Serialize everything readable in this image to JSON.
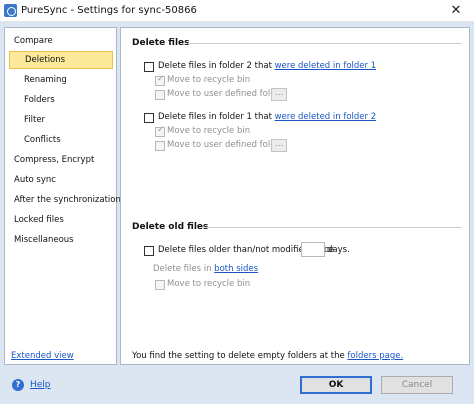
{
  "window": {
    "title": "PureSync - Settings for sync-50866",
    "close_glyph": "✕"
  },
  "sidebar": {
    "items": [
      {
        "label": "Compare"
      },
      {
        "label": "Deletions"
      },
      {
        "label": "Renaming"
      },
      {
        "label": "Folders"
      },
      {
        "label": "Filter"
      },
      {
        "label": "Conflicts"
      },
      {
        "label": "Compress, Encrypt"
      },
      {
        "label": "Auto sync"
      },
      {
        "label": "After the synchronization"
      },
      {
        "label": "Locked files"
      },
      {
        "label": "Miscellaneous"
      }
    ],
    "selected": "Deletions",
    "extended_view_link": "Extended view"
  },
  "delete_files": {
    "title": "Delete files",
    "folder2": {
      "label": "Delete files in folder 2 that",
      "link": "were deleted in folder 1",
      "checked": false,
      "recycle_label": "Move to recycle bin",
      "recycle_checked": true,
      "user_folder_label": "Move to user defined foler",
      "user_folder_checked": false,
      "browse_label": "..."
    },
    "folder1": {
      "label": "Delete files in folder 1 that",
      "link": "were deleted in folder 2",
      "checked": false,
      "recycle_label": "Move to recycle bin",
      "recycle_checked": true,
      "user_folder_label": "Move to user defined foler",
      "user_folder_checked": false,
      "browse_label": "..."
    }
  },
  "delete_old_files": {
    "title": "Delete old files",
    "older_than_label": "Delete files older than/not modified since",
    "older_than_checked": false,
    "days_value": "",
    "days_suffix": "days.",
    "delete_in_label": "Delete files in",
    "delete_in_link": "both sides",
    "recycle_label": "Move to recycle bin",
    "recycle_checked": false
  },
  "footer_note": {
    "text": "You find the setting to delete empty folders at the",
    "link": "folders page."
  },
  "bottom_bar": {
    "help_icon_glyph": "?",
    "help_label": "Help",
    "ok_label": "OK",
    "cancel_label": "Cancel"
  },
  "icons": {
    "app": "puresync-app-icon",
    "help": "help-icon",
    "close": "close-icon"
  }
}
